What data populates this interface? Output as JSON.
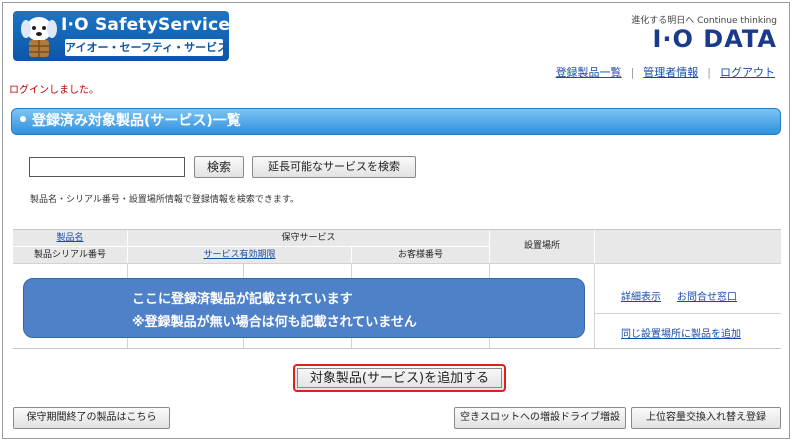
{
  "header": {
    "logo_title": "I·O SafetyService",
    "logo_subtitle": "アイオー・セーフティ・サービス",
    "brand_tagline": "進化する明日へ Continue thinking",
    "brand_name": "I·O DATA",
    "nav": {
      "registered_list": "登録製品一覧",
      "admin_info": "管理者情報",
      "logout": "ログアウト"
    },
    "login_message": "ログインしました。"
  },
  "section": {
    "title": "登録済み対象製品(サービス)一覧"
  },
  "search": {
    "input_value": "",
    "search_button": "検索",
    "extendable_button": "延長可能なサービスを検索",
    "hint": "製品名・シリアル番号・設置場所情報で登録情報を検索できます。"
  },
  "table": {
    "col_product_name": "製品名",
    "col_serial": "製品シリアル番号",
    "col_maintenance": "保守サービス",
    "col_valid_period": "サービス有効期限",
    "col_customer_no": "お客様番号",
    "col_location": "設置場所"
  },
  "notice": {
    "line1": "ここに登録済製品が記載されています",
    "line2": "※登録製品が無い場合は何も記載されていません"
  },
  "row_links": {
    "detail": "詳細表示",
    "contact": "お問合せ窓口",
    "add_same_location": "同じ設置場所に製品を追加"
  },
  "actions": {
    "add_product": "対象製品(サービス)を追加する",
    "expired_products": "保守期間終了の製品はこちら",
    "slot_drive_add": "空きスロットへの増設ドライブ増設",
    "upgrade_swap": "上位容量交換入れ替え登録"
  },
  "colors": {
    "accent_blue": "#2f91dc",
    "notice_blue": "#4f81c8",
    "link": "#1a4aa8",
    "highlight_red": "#e02020",
    "login_red": "#c00000"
  }
}
